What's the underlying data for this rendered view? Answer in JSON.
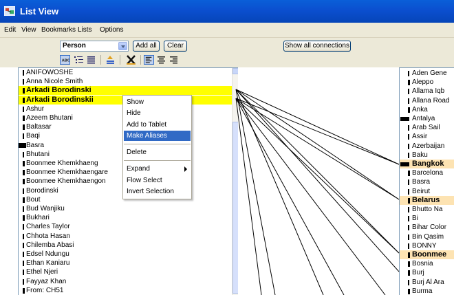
{
  "window": {
    "title": "List View"
  },
  "menu": [
    "Edit",
    "View",
    "Bookmarks",
    "Lists",
    "Options"
  ],
  "toolbar": {
    "type_select": "Person",
    "add_all": "Add all",
    "clear": "Clear",
    "show_all_connections": "Show all connections"
  },
  "left_list": [
    {
      "label": "ANIFOWOSHE",
      "w": 1
    },
    {
      "label": "Anna Nicole Smith",
      "w": 1
    },
    {
      "label": "Arkadi Borodinski",
      "w": 2,
      "hl": true
    },
    {
      "label": "Arkadi Borodinskii",
      "w": 2,
      "hl": true
    },
    {
      "label": "Ashur",
      "w": 1
    },
    {
      "label": "Azeem Bhutani",
      "w": 2
    },
    {
      "label": "Baltasar",
      "w": 2
    },
    {
      "label": "Baqi",
      "w": 1
    },
    {
      "label": "Basra",
      "w": 3
    },
    {
      "label": "Bhutani",
      "w": 1
    },
    {
      "label": "Boonmee Khemkhaeng",
      "w": 2
    },
    {
      "label": "Boonmee Khemkhaengare",
      "w": 2
    },
    {
      "label": "Boonmee Khemkhaengon",
      "w": 2
    },
    {
      "label": "Borodinski",
      "w": 1
    },
    {
      "label": "Bout",
      "w": 2
    },
    {
      "label": "Bud Wanjiku",
      "w": 1
    },
    {
      "label": "Bukhari",
      "w": 2
    },
    {
      "label": "Charles Taylor",
      "w": 1
    },
    {
      "label": "Chhota Hasan",
      "w": 1
    },
    {
      "label": "Chilemba Abasi",
      "w": 1
    },
    {
      "label": "Edsel Ndungu",
      "w": 1
    },
    {
      "label": "Ethan Kaniaru",
      "w": 1
    },
    {
      "label": "Ethel Njeri",
      "w": 1
    },
    {
      "label": "Fayyaz Khan",
      "w": 1
    },
    {
      "label": "From: CH51",
      "w": 2
    }
  ],
  "right_list": [
    {
      "label": "Aden Gene",
      "w": 1
    },
    {
      "label": "Aleppo",
      "w": 2
    },
    {
      "label": "Allama Iqb",
      "w": 1
    },
    {
      "label": "Allana Road",
      "w": 1
    },
    {
      "label": "Anka",
      "w": 2
    },
    {
      "label": "Antalya",
      "w": 3
    },
    {
      "label": "Arab Sail",
      "w": 1
    },
    {
      "label": "Assir",
      "w": 1
    },
    {
      "label": "Azerbaijan",
      "w": 1
    },
    {
      "label": "Baku",
      "w": 1
    },
    {
      "label": "Bangkok",
      "w": 3,
      "hl": true
    },
    {
      "label": "Barcelona",
      "w": 2
    },
    {
      "label": "Basra",
      "w": 1
    },
    {
      "label": "Beirut",
      "w": 1
    },
    {
      "label": "Belarus",
      "w": 2,
      "hl": true
    },
    {
      "label": "Bhutto Na",
      "w": 1
    },
    {
      "label": "Bi",
      "w": 1
    },
    {
      "label": "Bihar Color",
      "w": 1
    },
    {
      "label": "Bin Qasim",
      "w": 1
    },
    {
      "label": "BONNY",
      "w": 1
    },
    {
      "label": "Boonmee",
      "w": 2,
      "hl": true
    },
    {
      "label": "Bosnia",
      "w": 2
    },
    {
      "label": "Burj",
      "w": 2
    },
    {
      "label": "Burj Al Ara",
      "w": 1
    },
    {
      "label": "Burma",
      "w": 2
    }
  ],
  "context_menu": {
    "items": [
      "Show",
      "Hide",
      "Add to Tablet",
      "Make Aliases",
      "Delete",
      "Expand",
      "Flow Select",
      "Invert Selection"
    ],
    "selected": "Make Aliases"
  },
  "icons": [
    "abc-text-icon",
    "tree-list-icon",
    "list-icon",
    "sort-icon",
    "remove-x-icon",
    "align-left-icon",
    "align-center-icon",
    "align-right-icon"
  ],
  "colors": {
    "title_bar": "#0b4fcf",
    "selected_row": "#ffff00",
    "highlight_right": "#fde3b2",
    "menu_selection": "#316ac5"
  }
}
